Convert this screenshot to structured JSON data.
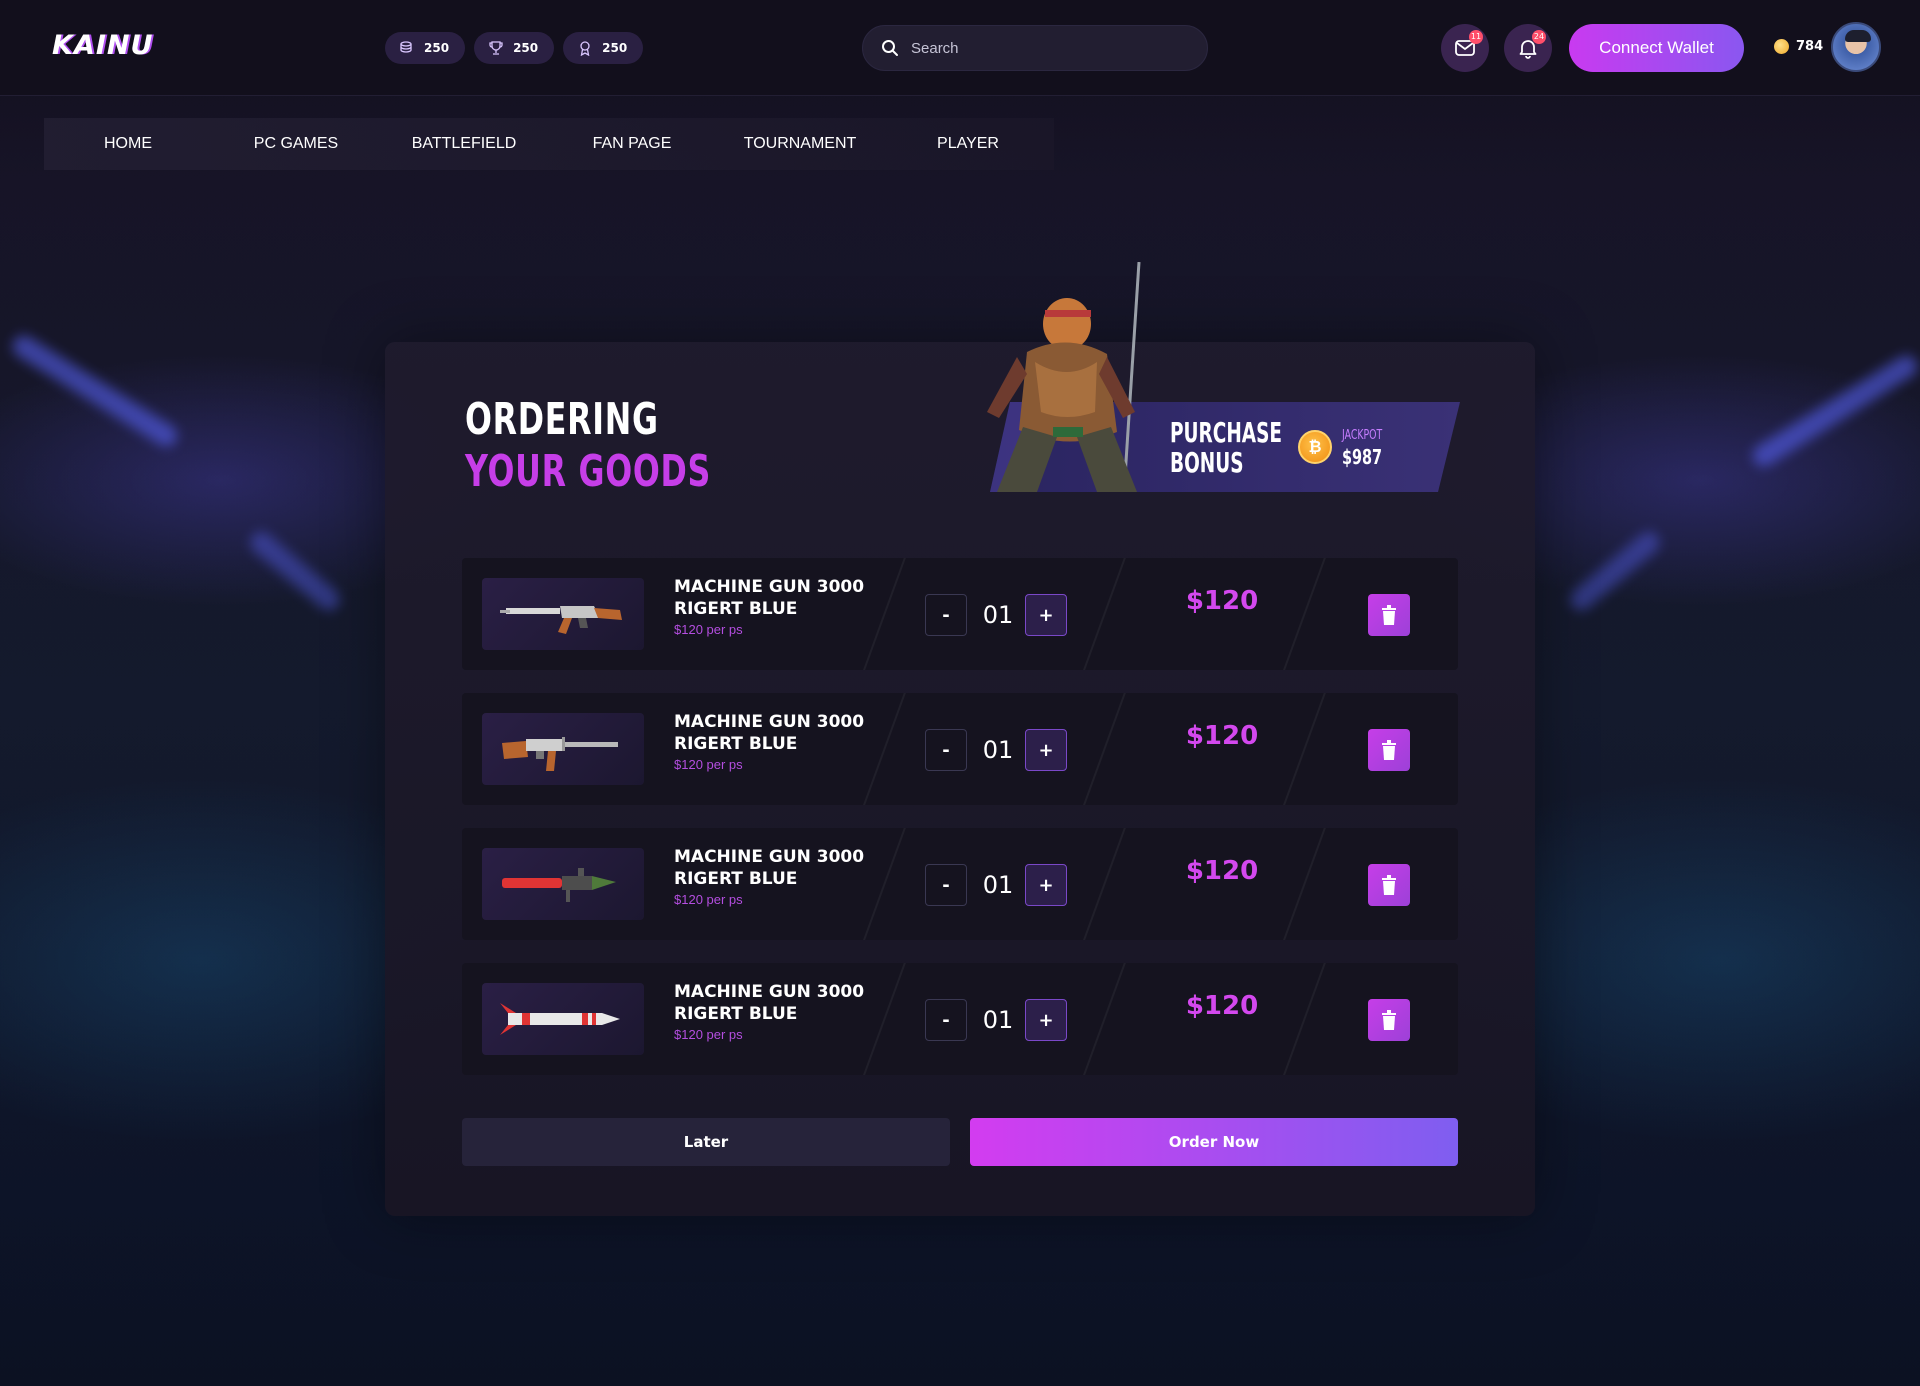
{
  "app": {
    "logo": "KAINU"
  },
  "header": {
    "stats": [
      {
        "icon": "coins-icon",
        "value": "250"
      },
      {
        "icon": "trophy-icon",
        "value": "250"
      },
      {
        "icon": "medal-icon",
        "value": "250"
      }
    ],
    "search": {
      "placeholder": "Search",
      "value": ""
    },
    "mail": {
      "icon": "mail-icon",
      "badge": "11"
    },
    "notifications": {
      "icon": "bell-icon",
      "badge": "24"
    },
    "connect_label": "Connect Wallet",
    "balance": "784"
  },
  "nav": [
    "HOME",
    "PC GAMES",
    "BATTLEFIELD",
    "FAN PAGE",
    "TOURNAMENT",
    "PLAYER"
  ],
  "order": {
    "title_line1": "ORDERING",
    "title_line2": "YOUR GOODS",
    "bonus": {
      "label": "PURCHASE BONUS",
      "jackpot_label": "JACKPOT",
      "jackpot_value": "$987",
      "coin_symbol": "₿"
    },
    "items": [
      {
        "name": "MACHINE GUN 3000 RIGERT BLUE",
        "unit": "$120 per ps",
        "qty": "01",
        "price": "$120",
        "image": "assault-rifle-image"
      },
      {
        "name": "MACHINE GUN 3000 RIGERT BLUE",
        "unit": "$120 per ps",
        "qty": "01",
        "price": "$120",
        "image": "machine-gun-image"
      },
      {
        "name": "MACHINE GUN 3000 RIGERT BLUE",
        "unit": "$120 per ps",
        "qty": "01",
        "price": "$120",
        "image": "rocket-launcher-image"
      },
      {
        "name": "MACHINE GUN 3000 RIGERT BLUE",
        "unit": "$120 per ps",
        "qty": "01",
        "price": "$120",
        "image": "missile-image"
      }
    ],
    "minus_label": "-",
    "plus_label": "+",
    "later_label": "Later",
    "order_label": "Order Now"
  },
  "colors": {
    "accent": "#c63ee8",
    "accent_gradient_end": "#7f5ef0",
    "background": "#120f1c",
    "row_background": "#15131f"
  }
}
